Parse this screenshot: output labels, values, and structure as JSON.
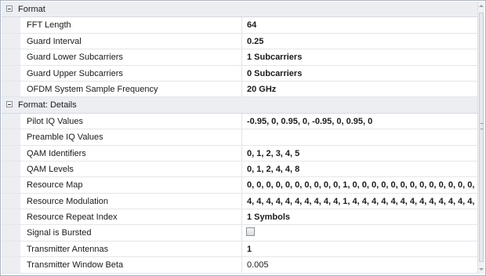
{
  "categories": [
    {
      "label": "Format",
      "properties": [
        {
          "name": "FFT Length",
          "value": "64"
        },
        {
          "name": "Guard Interval",
          "value": "0.25"
        },
        {
          "name": "Guard Lower Subcarriers",
          "value": "1 Subcarriers"
        },
        {
          "name": "Guard Upper Subcarriers",
          "value": "0 Subcarriers"
        },
        {
          "name": "OFDM System Sample Frequency",
          "value": "20 GHz"
        }
      ]
    },
    {
      "label": "Format: Details",
      "properties": [
        {
          "name": "Pilot IQ Values",
          "value": "-0.95, 0, 0.95, 0, -0.95, 0, 0.95, 0"
        },
        {
          "name": "Preamble IQ Values",
          "value": ""
        },
        {
          "name": "QAM Identifiers",
          "value": "0, 1, 2, 3, 4, 5"
        },
        {
          "name": "QAM Levels",
          "value": "0, 1, 2, 4, 4, 8"
        },
        {
          "name": "Resource Map",
          "value": "0, 0, 0, 0, 0, 0, 0, 0, 0, 0, 1, 0, 0, 0, 0, 0, 0, 0, 0, 0, 0, 0, 0, 0,"
        },
        {
          "name": "Resource Modulation",
          "value": "4, 4, 4, 4, 4, 4, 4, 4, 4, 4, 1, 4, 4, 4, 4, 4, 4, 4, 4, 4, 4, 4, 4, 4,"
        },
        {
          "name": "Resource Repeat Index",
          "value": "1 Symbols"
        },
        {
          "name": "Signal is Bursted",
          "checked": false
        },
        {
          "name": "Transmitter Antennas",
          "value": "1"
        },
        {
          "name": "Transmitter Window Beta",
          "value": "0.005"
        }
      ]
    }
  ]
}
